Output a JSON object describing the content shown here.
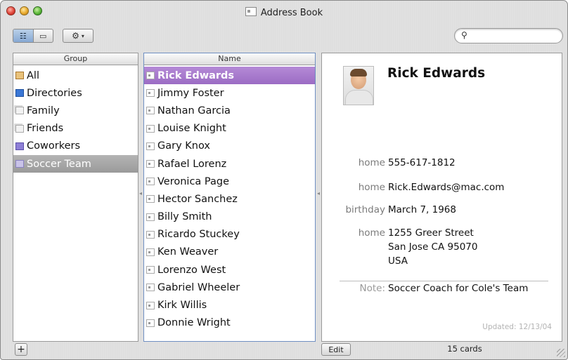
{
  "window": {
    "title": "Address Book"
  },
  "toolbar": {
    "view_icons": [
      "view-columns-icon",
      "view-card-icon"
    ],
    "action_icon": "gear-icon",
    "search_placeholder": ""
  },
  "groups": {
    "header": "Group",
    "items": [
      {
        "label": "All",
        "icon": "all-book-icon"
      },
      {
        "label": "Directories",
        "icon": "directory-icon"
      },
      {
        "label": "Family",
        "icon": "group-icon"
      },
      {
        "label": "Friends",
        "icon": "group-icon"
      },
      {
        "label": "Coworkers",
        "icon": "smart-group-icon"
      },
      {
        "label": "Soccer Team",
        "icon": "smart-group-icon",
        "selected": true
      }
    ]
  },
  "names": {
    "header": "Name",
    "items": [
      "Rick Edwards",
      "Jimmy Foster",
      "Nathan Garcia",
      "Louise Knight",
      "Gary Knox",
      "Rafael Lorenz",
      "Veronica Page",
      "Hector Sanchez",
      "Billy Smith",
      "Ricardo Stuckey",
      "Ken Weaver",
      "Lorenzo West",
      "Gabriel Wheeler",
      "Kirk Willis",
      "Donnie Wright"
    ],
    "selected_index": 0
  },
  "card": {
    "name": "Rick Edwards",
    "phone": {
      "label": "home",
      "value": "555-617-1812"
    },
    "email": {
      "label": "home",
      "value": "Rick.Edwards@mac.com"
    },
    "birthday": {
      "label": "birthday",
      "value": "March 7, 1968"
    },
    "address": {
      "label": "home",
      "line1": "1255 Greer Street",
      "line2": "San Jose CA 95070",
      "line3": "USA"
    },
    "note": {
      "label": "Note:",
      "value": "Soccer Coach for Cole's Team"
    },
    "updated": "Updated: 12/13/04"
  },
  "footer": {
    "add_label": "+",
    "edit_label": "Edit",
    "count": "15 cards"
  },
  "colors": {
    "selected_name": "#a67bcc",
    "selected_group": "#a6a6a6"
  }
}
